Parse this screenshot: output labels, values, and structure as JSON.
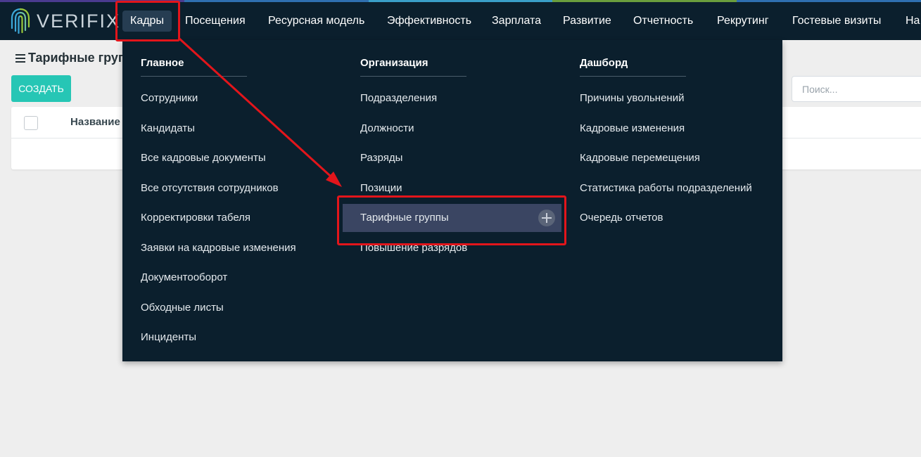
{
  "colors": {
    "navbar_bg": "#0b1f2d",
    "menu_bg": "#0b1f2d",
    "accent": "#26c6b5",
    "highlight_bg": "#3a4562",
    "annotation": "#e3151b",
    "strip": [
      "#4a3b8f",
      "#2f6fb0",
      "#3a9fc8",
      "#6a9e3d",
      "#2f6fb0"
    ]
  },
  "logo": {
    "text": "VERIFIX",
    "icon": "fingerprint-icon"
  },
  "nav": {
    "items": [
      {
        "label": "Кадры",
        "active": true
      },
      {
        "label": "Посещения"
      },
      {
        "label": "Ресурсная модель"
      },
      {
        "label": "Эффективность"
      },
      {
        "label": "Зарплата"
      },
      {
        "label": "Развитие"
      },
      {
        "label": "Отчетность"
      },
      {
        "label": "Рекрутинг"
      },
      {
        "label": "Гостевые визиты"
      },
      {
        "label": "На"
      }
    ]
  },
  "page": {
    "title": "Тарифные груп",
    "create_label": "СОЗДАТЬ",
    "search_placeholder": "Поиск...",
    "column_name": "Название"
  },
  "menu": {
    "columns": [
      {
        "heading": "Главное",
        "items": [
          "Сотрудники",
          "Кандидаты",
          "Все кадровые документы",
          "Все отсутствия сотрудников",
          "Корректировки табеля",
          "Заявки на кадровые изменения",
          "Документооборот",
          "Обходные листы",
          "Инциденты"
        ]
      },
      {
        "heading": "Организация",
        "items": [
          "Подразделения",
          "Должности",
          "Разряды",
          "Позиции",
          "Тарифные группы",
          "Повышение разрядов"
        ],
        "highlighted_index": 4
      },
      {
        "heading": "Дашборд",
        "items": [
          "Причины увольнений",
          "Кадровые изменения",
          "Кадровые перемещения",
          "Статистика работы подразделений",
          "Очередь отчетов"
        ]
      }
    ]
  }
}
